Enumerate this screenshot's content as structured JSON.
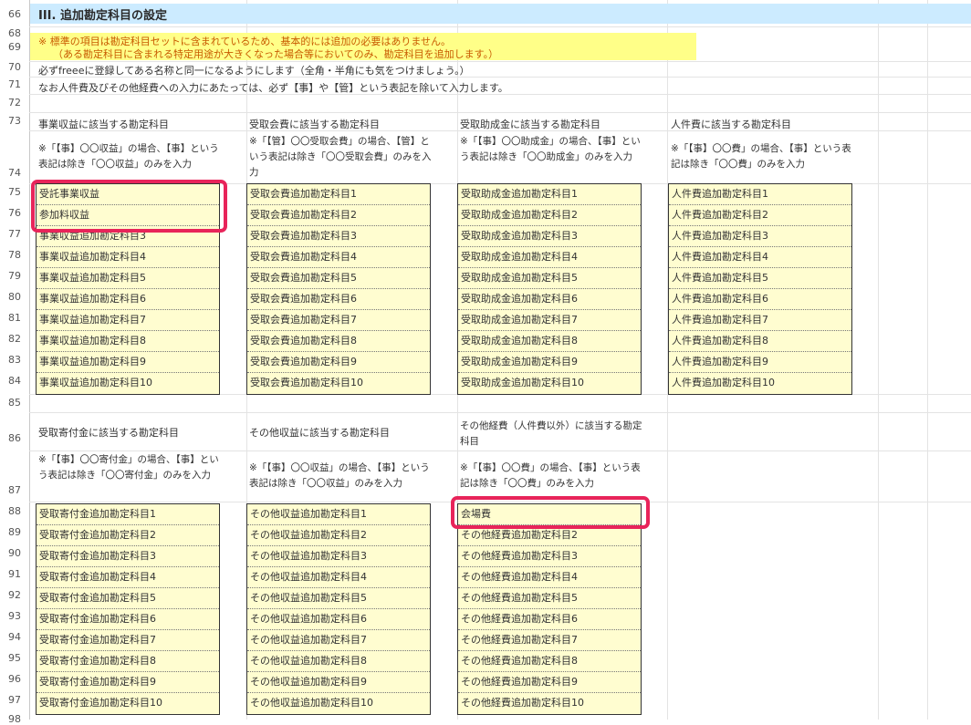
{
  "title": "III. 追加勘定科目の設定",
  "notes": [
    "※ 標準の項目は勘定科目セットに含まれているため、基本的には追加の必要はありません。",
    "（ある勘定科目に含まれる特定用途が大きくなった場合等においてのみ、勘定科目を追加します。）"
  ],
  "lines": [
    "必ずfreeeに登録してある名称と同一になるようにします（全角・半角にも気をつけましょう。）",
    "なお人件費及びその他経費への入力にあたっては、必ず【事】や【管】という表記を除いて入力します。"
  ],
  "row_numbers": [
    "66",
    "68",
    "69",
    "70",
    "71",
    "72",
    "73",
    "74",
    "75",
    "76",
    "77",
    "78",
    "79",
    "80",
    "81",
    "82",
    "83",
    "84",
    "85",
    "86",
    "87",
    "88",
    "89",
    "90",
    "91",
    "92",
    "93",
    "94",
    "95",
    "96",
    "97",
    "98"
  ],
  "sections": [
    {
      "header": "事業収益に該当する勘定科目",
      "desc": "※「【事】〇〇収益」の場合、【事】という表記は除き「〇〇収益」のみを入力",
      "items": [
        "受託事業収益",
        "参加料収益",
        "事業収益追加勘定科目3",
        "事業収益追加勘定科目4",
        "事業収益追加勘定科目5",
        "事業収益追加勘定科目6",
        "事業収益追加勘定科目7",
        "事業収益追加勘定科目8",
        "事業収益追加勘定科目9",
        "事業収益追加勘定科目10"
      ]
    },
    {
      "header": "受取会費に該当する勘定科目",
      "desc": "※「【管】〇〇受取会費」の場合、【管】という表記は除き「〇〇受取会費」のみを入力",
      "items": [
        "受取会費追加勘定科目1",
        "受取会費追加勘定科目2",
        "受取会費追加勘定科目3",
        "受取会費追加勘定科目4",
        "受取会費追加勘定科目5",
        "受取会費追加勘定科目6",
        "受取会費追加勘定科目7",
        "受取会費追加勘定科目8",
        "受取会費追加勘定科目9",
        "受取会費追加勘定科目10"
      ]
    },
    {
      "header": "受取助成金に該当する勘定科目",
      "desc": "※「【事】〇〇助成金」の場合、【事】という表記は除き「〇〇助成金」のみを入力",
      "items": [
        "受取助成金追加勘定科目1",
        "受取助成金追加勘定科目2",
        "受取助成金追加勘定科目3",
        "受取助成金追加勘定科目4",
        "受取助成金追加勘定科目5",
        "受取助成金追加勘定科目6",
        "受取助成金追加勘定科目7",
        "受取助成金追加勘定科目8",
        "受取助成金追加勘定科目9",
        "受取助成金追加勘定科目10"
      ]
    },
    {
      "header": "人件費に該当する勘定科目",
      "desc": "※「【事】〇〇費」の場合、【事】という表記は除き「〇〇費」のみを入力",
      "items": [
        "人件費追加勘定科目1",
        "人件費追加勘定科目2",
        "人件費追加勘定科目3",
        "人件費追加勘定科目4",
        "人件費追加勘定科目5",
        "人件費追加勘定科目6",
        "人件費追加勘定科目7",
        "人件費追加勘定科目8",
        "人件費追加勘定科目9",
        "人件費追加勘定科目10"
      ]
    },
    {
      "header": "受取寄付金に該当する勘定科目",
      "desc": "※「【事】〇〇寄付金」の場合、【事】という表記は除き「〇〇寄付金」のみを入力",
      "items": [
        "受取寄付金追加勘定科目1",
        "受取寄付金追加勘定科目2",
        "受取寄付金追加勘定科目3",
        "受取寄付金追加勘定科目4",
        "受取寄付金追加勘定科目5",
        "受取寄付金追加勘定科目6",
        "受取寄付金追加勘定科目7",
        "受取寄付金追加勘定科目8",
        "受取寄付金追加勘定科目9",
        "受取寄付金追加勘定科目10"
      ]
    },
    {
      "header": "その他収益に該当する勘定科目",
      "desc": "※「【事】〇〇収益」の場合、【事】という表記は除き「〇〇収益」のみを入力",
      "items": [
        "その他収益追加勘定科目1",
        "その他収益追加勘定科目2",
        "その他収益追加勘定科目3",
        "その他収益追加勘定科目4",
        "その他収益追加勘定科目5",
        "その他収益追加勘定科目6",
        "その他収益追加勘定科目7",
        "その他収益追加勘定科目8",
        "その他収益追加勘定科目9",
        "その他収益追加勘定科目10"
      ]
    },
    {
      "header": "その他経費（人件費以外）に該当する勘定科目",
      "desc": "※「【事】〇〇費」の場合、【事】という表記は除き「〇〇費」のみを入力",
      "items": [
        "会場費",
        "その他経費追加勘定科目2",
        "その他経費追加勘定科目3",
        "その他経費追加勘定科目4",
        "その他経費追加勘定科目5",
        "その他経費追加勘定科目6",
        "その他経費追加勘定科目7",
        "その他経費追加勘定科目8",
        "その他経費追加勘定科目9",
        "その他経費追加勘定科目10"
      ]
    }
  ],
  "highlight_color": "#e8245a"
}
